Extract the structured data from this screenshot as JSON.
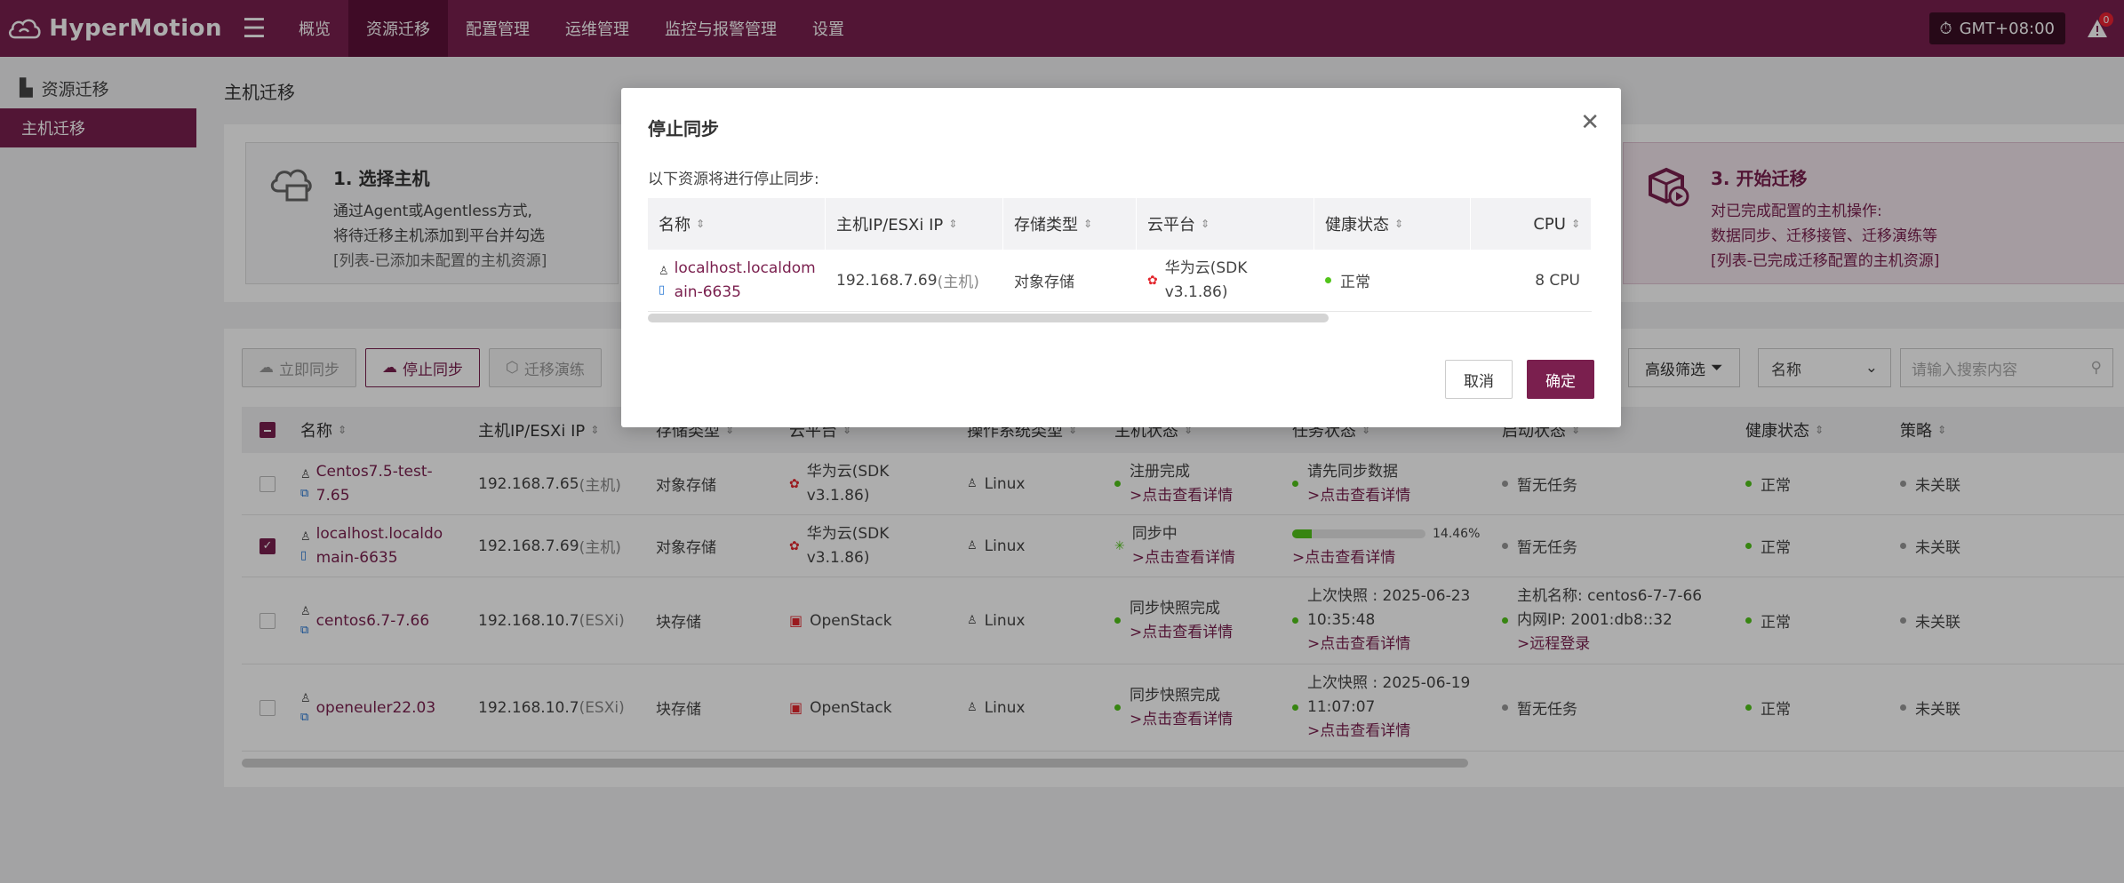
{
  "header": {
    "brand": "HyperMotion",
    "nav": [
      {
        "label": "概览"
      },
      {
        "label": "资源迁移"
      },
      {
        "label": "配置管理"
      },
      {
        "label": "运维管理"
      },
      {
        "label": "监控与报警管理"
      },
      {
        "label": "设置"
      }
    ],
    "timezone": "GMT+08:00",
    "alert_count": "0",
    "menu_glyph": "☰"
  },
  "sidebar": {
    "group": "资源迁移",
    "item": "主机迁移"
  },
  "page": {
    "title": "主机迁移"
  },
  "steps": {
    "s1": {
      "title": "1. 选择主机",
      "lines": [
        "通过Agent或Agentless方式,",
        "将待迁移主机添加到平台并勾选",
        "[列表-已添加未配置的主机资源]"
      ]
    },
    "s3": {
      "title": "3. 开始迁移",
      "lines": [
        "对已完成配置的主机操作:",
        "数据同步、迁移接管、迁移演练等",
        "[列表-已完成迁移配置的主机资源]"
      ]
    }
  },
  "toolbar": {
    "sync_now": "立即同步",
    "stop_sync": "停止同步",
    "drill": "迁移演练",
    "adv_filter": "高级筛选",
    "filter_field": "名称",
    "search_placeholder": "请输入搜索内容"
  },
  "table": {
    "headers": [
      "名称",
      "主机IP/ESXi IP",
      "存储类型",
      "云平台",
      "操作系统类型",
      "主机状态",
      "任务状态",
      "启动状态",
      "健康状态",
      "策略"
    ],
    "rows": [
      {
        "name1": "Centos7.5-test-",
        "name2": "7.65",
        "ip": "192.168.7.65",
        "ip_tag": "(主机)",
        "store": "对象存储",
        "cloud1": "华为云(SDK",
        "cloud2": "v3.1.86)",
        "os": "Linux",
        "host1": "注册完成",
        "host2": ">点击查看详情",
        "task1": "请先同步数据",
        "task2": ">点击查看详情",
        "boot": "暂无任务",
        "health": "正常",
        "policy": "未关联",
        "checked": false
      },
      {
        "name1": "localhost.localdo",
        "name2": "main-6635",
        "ip": "192.168.7.69",
        "ip_tag": "(主机)",
        "store": "对象存储",
        "cloud1": "华为云(SDK",
        "cloud2": "v3.1.86)",
        "os": "Linux",
        "host1": "同步中",
        "host2": ">点击查看详情",
        "progress": 14.46,
        "progress_text": "14.46%",
        "task2": ">点击查看详情",
        "boot": "暂无任务",
        "health": "正常",
        "policy": "未关联",
        "checked": true
      },
      {
        "name1": "centos6.7-7.66",
        "ip": "192.168.10.7",
        "ip_tag": "(ESXi)",
        "store": "块存储",
        "cloud1": "OpenStack",
        "os": "Linux",
        "host1": "同步快照完成",
        "host2": ">点击查看详情",
        "task1": "上次快照 : 2025-06-23",
        "task1b": "10:35:48",
        "task2": ">点击查看详情",
        "boot1": "主机名称: centos6-7-7-66",
        "boot2": "内网IP: 2001:db8::32",
        "boot3": ">远程登录",
        "health": "正常",
        "policy": "未关联",
        "checked": false
      },
      {
        "name1": "openeuler22.03",
        "ip": "192.168.10.7",
        "ip_tag": "(ESXi)",
        "store": "块存储",
        "cloud1": "OpenStack",
        "os": "Linux",
        "host1": "同步快照完成",
        "host2": ">点击查看详情",
        "task1": "上次快照 : 2025-06-19",
        "task1b": "11:07:07",
        "task2": ">点击查看详情",
        "boot": "暂无任务",
        "health": "正常",
        "policy": "未关联",
        "checked": false
      }
    ]
  },
  "modal": {
    "title": "停止同步",
    "desc": "以下资源将进行停止同步:",
    "headers": [
      "名称",
      "主机IP/ESXi IP",
      "存储类型",
      "云平台",
      "健康状态",
      "CPU"
    ],
    "row": {
      "name1": "localhost.localdom",
      "name2": "ain-6635",
      "ip": "192.168.7.69",
      "ip_tag": "(主机)",
      "store": "对象存储",
      "cloud1": "华为云(SDK",
      "cloud2": "v3.1.86)",
      "health": "正常",
      "cpu": "8 CPU"
    },
    "cancel": "取消",
    "ok": "确定"
  },
  "colors": {
    "brand": "#7a1f4e",
    "success": "#52c41a"
  }
}
